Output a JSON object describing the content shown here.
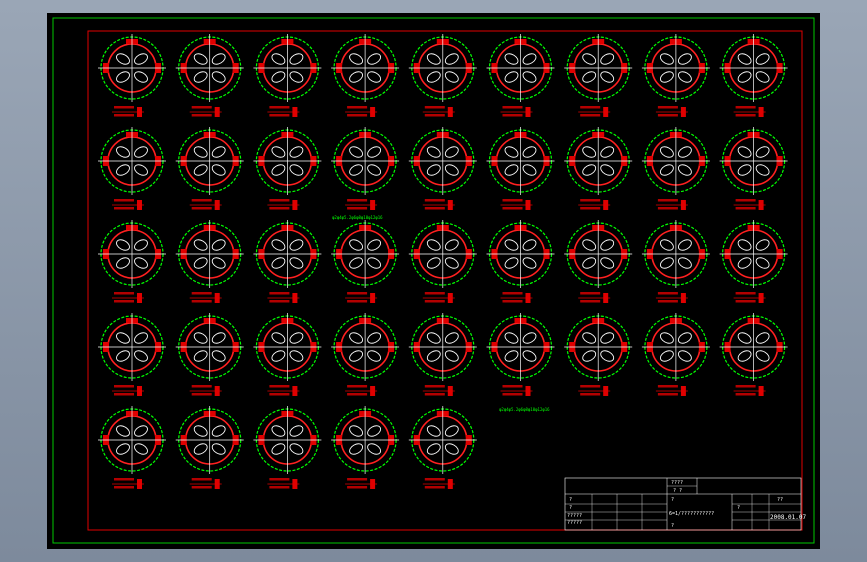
{
  "drawing": {
    "background": "#000000",
    "frame_color": "#00c800",
    "border_color": "#e00000",
    "rows": [
      9,
      9,
      9,
      9,
      5
    ]
  },
  "notes": [
    {
      "text": "φ2φ4φ5.2φ6φ8φ10φ12φ16"
    },
    {
      "text": "φ2φ4φ5.2φ6φ8φ10φ12φ16"
    }
  ],
  "title_block": {
    "heading": "????",
    "subheading": "? ?",
    "drawing_name": "6=1/???????????",
    "date": "2008.01.07",
    "scale": "??",
    "sheet": "?",
    "rows": [
      "?",
      "?",
      "?????",
      "?????",
      "?",
      "?"
    ]
  }
}
